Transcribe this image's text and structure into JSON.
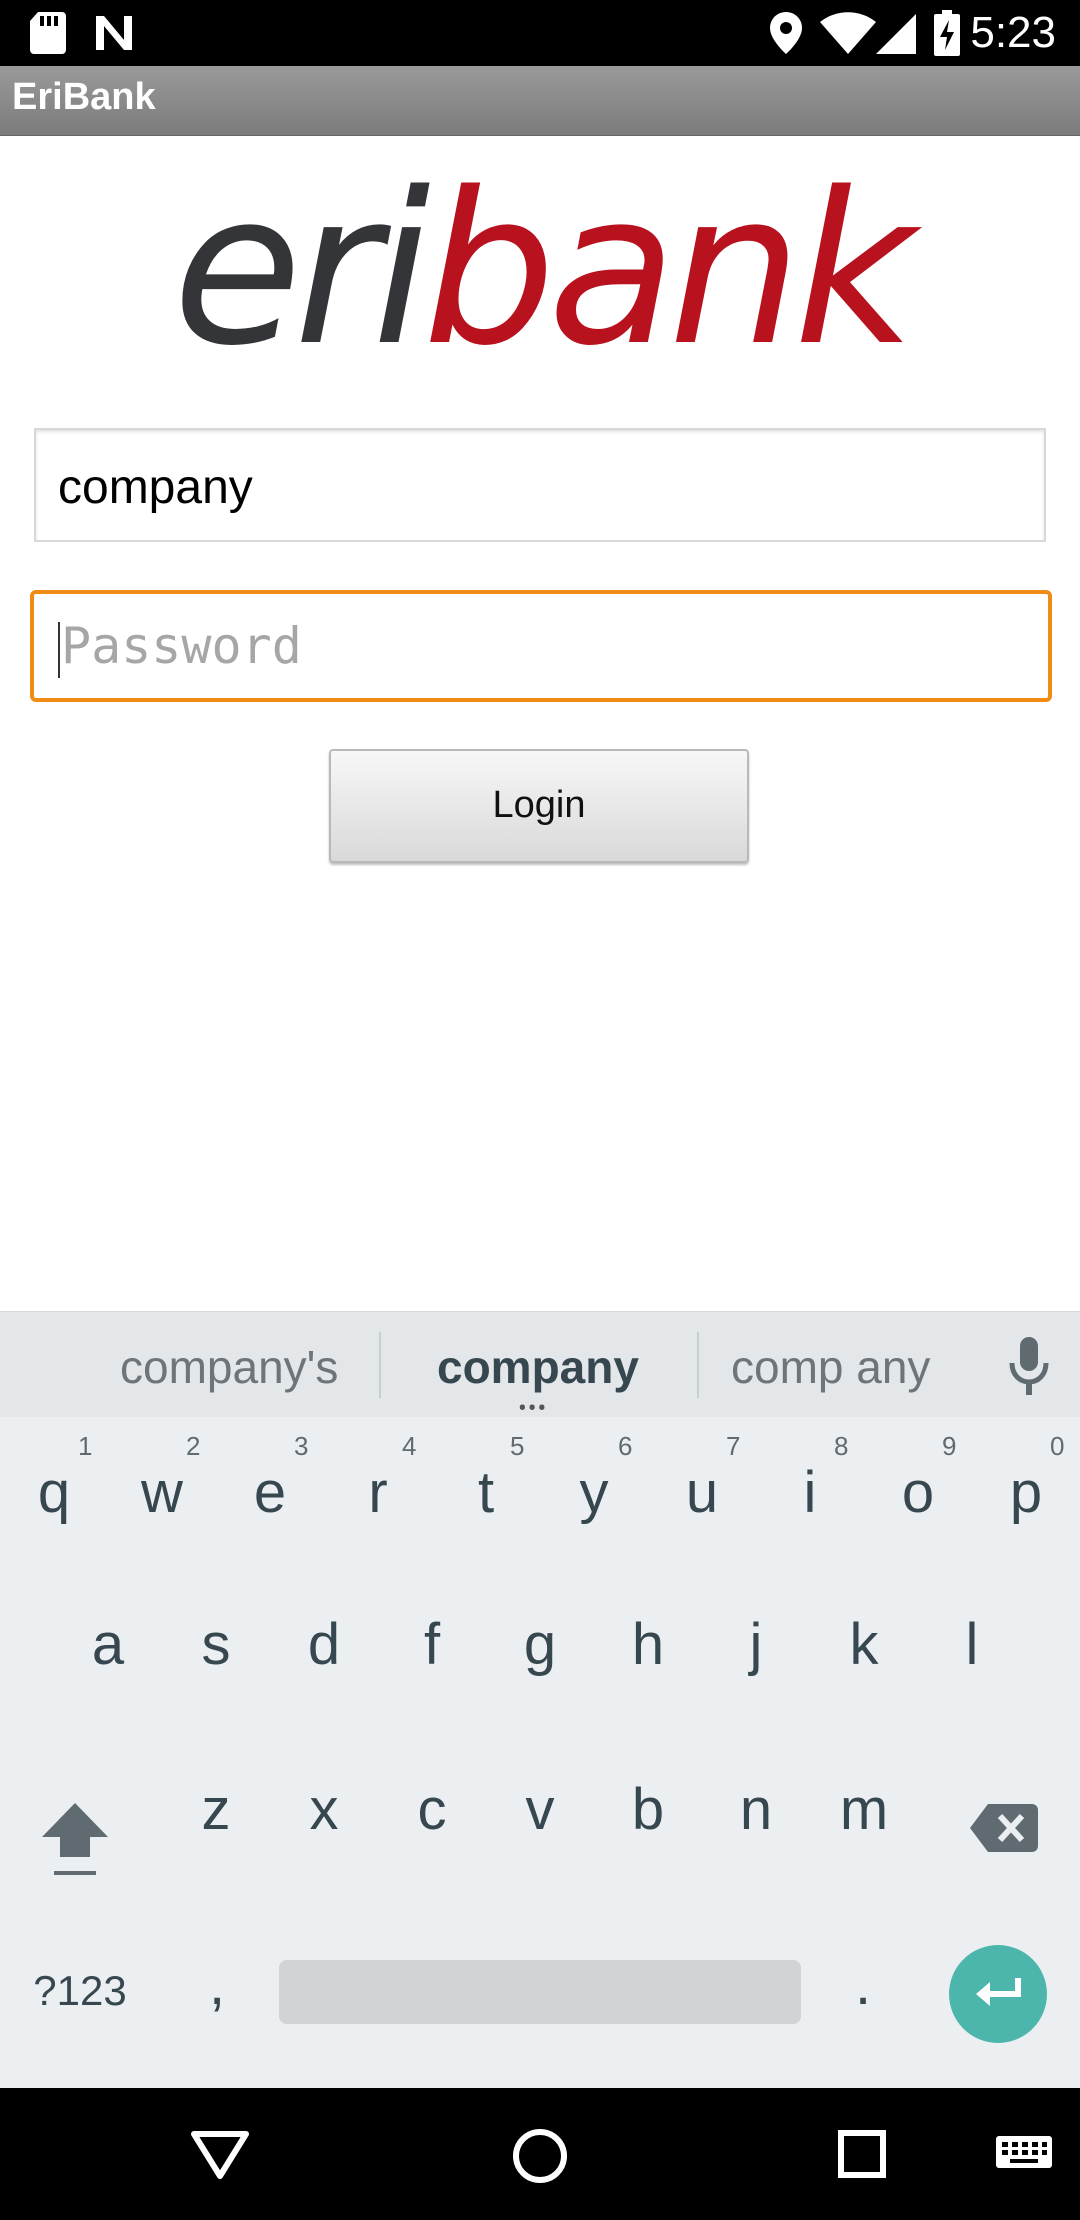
{
  "status_bar": {
    "time": "5:23",
    "icons": [
      "sd-card-icon",
      "n-notification-icon",
      "location-icon",
      "wifi-icon",
      "cell-signal-icon",
      "battery-charging-icon"
    ]
  },
  "app_bar": {
    "title": "EriBank"
  },
  "logo": {
    "part1": "eri",
    "part2": "bank",
    "color_dark": "#333538",
    "color_red": "#b8121f"
  },
  "login_form": {
    "username_value": "company",
    "password_placeholder": "Password",
    "login_label": "Login",
    "focus_color": "#f08c13"
  },
  "keyboard": {
    "suggestions": [
      "company's",
      "company",
      "comp any"
    ],
    "more_indicator": "•••",
    "row1": [
      {
        "key": "q",
        "hint": "1"
      },
      {
        "key": "w",
        "hint": "2"
      },
      {
        "key": "e",
        "hint": "3"
      },
      {
        "key": "r",
        "hint": "4"
      },
      {
        "key": "t",
        "hint": "5"
      },
      {
        "key": "y",
        "hint": "6"
      },
      {
        "key": "u",
        "hint": "7"
      },
      {
        "key": "i",
        "hint": "8"
      },
      {
        "key": "o",
        "hint": "9"
      },
      {
        "key": "p",
        "hint": "0"
      }
    ],
    "row2": [
      "a",
      "s",
      "d",
      "f",
      "g",
      "h",
      "j",
      "k",
      "l"
    ],
    "row3": [
      "z",
      "x",
      "c",
      "v",
      "b",
      "n",
      "m"
    ],
    "symbols_label": "?123",
    "comma": ",",
    "period": ".",
    "accent_color": "#4db6ac"
  },
  "nav_bar": {
    "icons": [
      "back-icon",
      "home-icon",
      "recents-icon",
      "keyboard-switch-icon"
    ]
  }
}
